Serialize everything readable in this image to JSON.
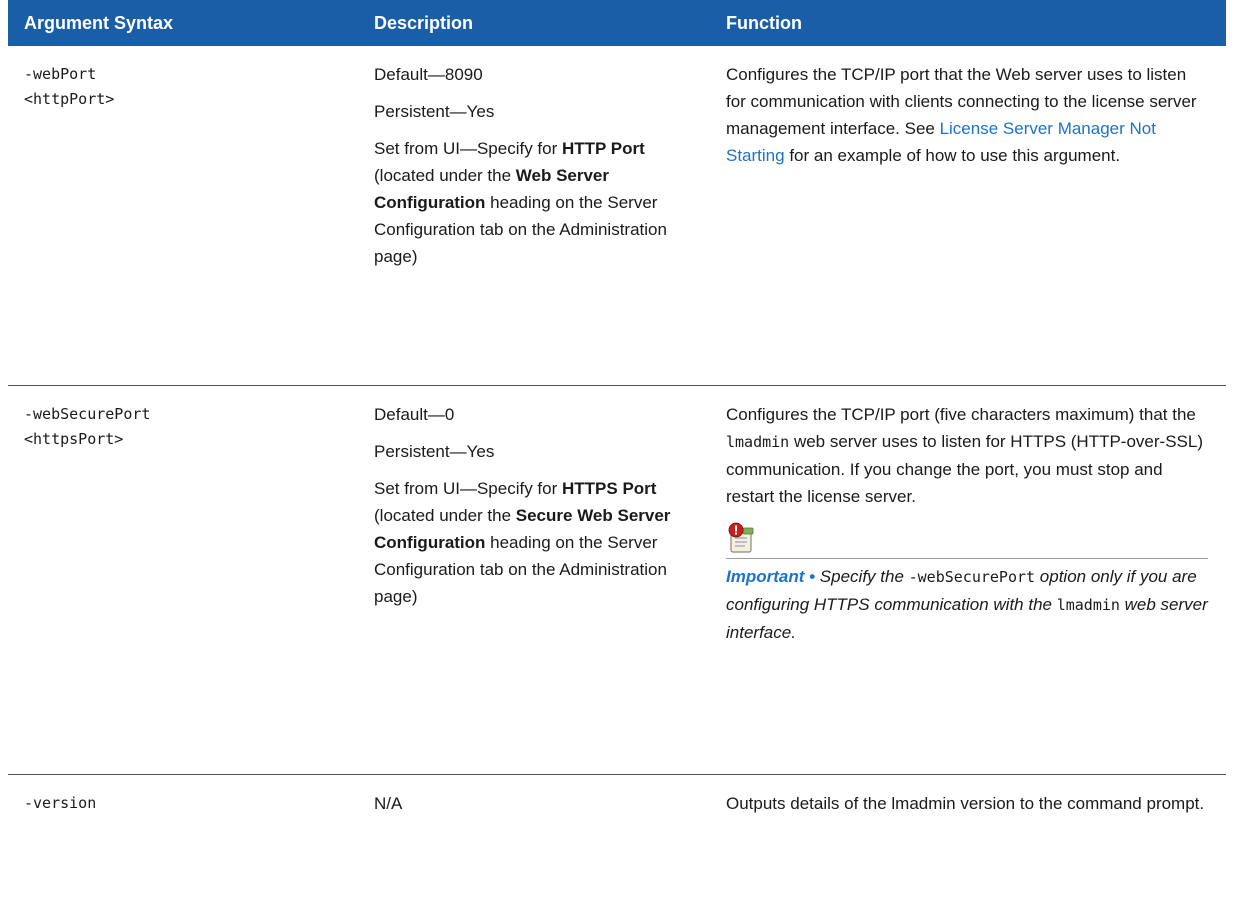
{
  "headers": {
    "argument": "Argument Syntax",
    "description": "Description",
    "function": "Function"
  },
  "rows": [
    {
      "argument_line1": "-webPort",
      "argument_line2": "<httpPort>",
      "default": "Default—8090",
      "persistent": "Persistent—Yes",
      "set_prefix": "Set from UI—Specify for ",
      "set_bold1": "HTTP Port",
      "set_mid1": " (located under the ",
      "set_bold2": "Web Server Configuration",
      "set_suffix": " heading on the Server Configuration tab on the Administration page)",
      "function_prefix": "Configures the TCP/IP port that the Web server uses to listen for communication with clients connecting to the license server management interface. See ",
      "function_link": "License Server Manager Not Starting",
      "function_suffix": " for an example of how to use this argument."
    },
    {
      "argument_line1": "-webSecurePort",
      "argument_line2": "<httpsPort>",
      "default": "Default—0",
      "persistent": "Persistent—Yes",
      "set_prefix": "Set from UI—Specify for ",
      "set_bold1": "HTTPS Port",
      "set_mid1": " (located under the ",
      "set_bold2": "Secure Web Server Configuration",
      "set_suffix": " heading on the Server Configuration tab on the Administration page)",
      "function_prefix": "Configures the TCP/IP port (five characters maximum) that the ",
      "function_code": "lmadmin",
      "function_suffix": " web server uses to listen for HTTPS (HTTP-over-SSL) communication. If you change the port, you must stop and restart the license server.",
      "note_icon": "important-note-icon",
      "note_label": "Important • ",
      "note_prefix": "Specify the ",
      "note_code1": "-webSecurePort",
      "note_mid": " option only if you are configuring HTTPS communication with the  ",
      "note_code2": "lmadmin",
      "note_suffix": " web server interface."
    },
    {
      "argument_line1": "-version",
      "default": "N/A",
      "function_text": "Outputs details of the lmadmin version to the command prompt."
    }
  ],
  "colors": {
    "header_bg": "#1b5ea8",
    "link": "#1e73c8"
  }
}
